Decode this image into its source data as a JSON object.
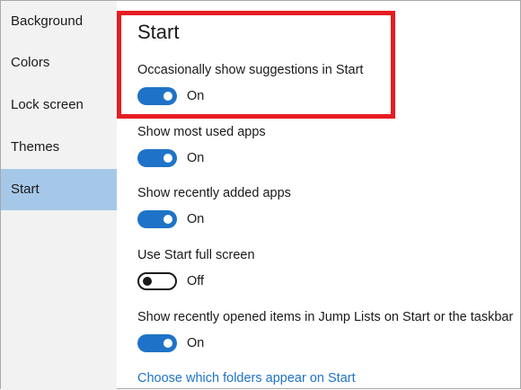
{
  "sidebar": {
    "items": [
      {
        "label": "Background"
      },
      {
        "label": "Colors"
      },
      {
        "label": "Lock screen"
      },
      {
        "label": "Themes"
      },
      {
        "label": "Start"
      }
    ]
  },
  "main": {
    "title": "Start",
    "settings": [
      {
        "label": "Occasionally show suggestions in Start",
        "state": "On",
        "on": true
      },
      {
        "label": "Show most used apps",
        "state": "On",
        "on": true
      },
      {
        "label": "Show recently added apps",
        "state": "On",
        "on": true
      },
      {
        "label": "Use Start full screen",
        "state": "Off",
        "on": false
      },
      {
        "label": "Show recently opened items in Jump Lists on Start or the taskbar",
        "state": "On",
        "on": true
      }
    ],
    "link": "Choose which folders appear on Start"
  },
  "colors": {
    "accent": "#1e73c8",
    "selected_nav": "#a6c8e8",
    "highlight": "#e51c23"
  }
}
